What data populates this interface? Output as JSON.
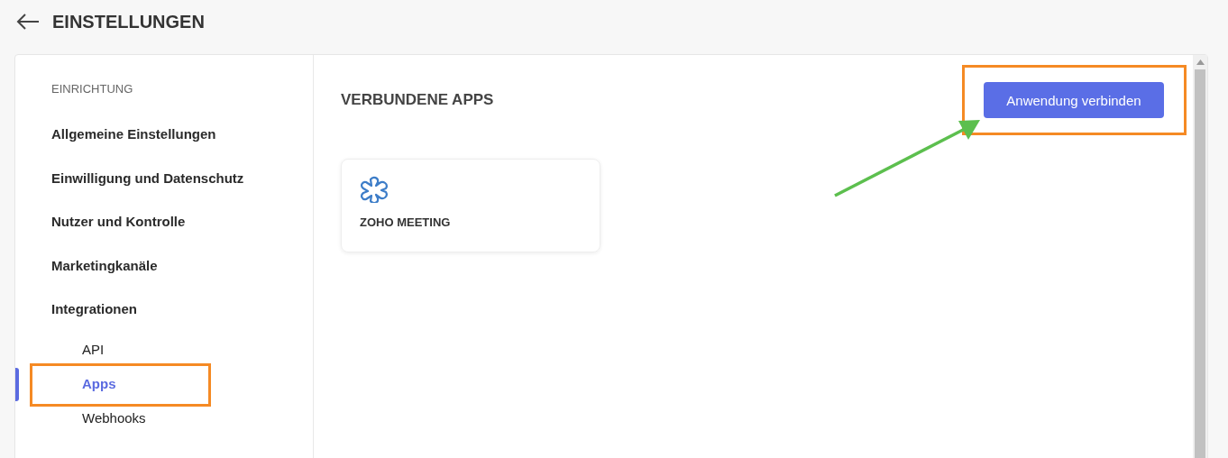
{
  "header": {
    "title": "EINSTELLUNGEN"
  },
  "sidebar": {
    "section": "EINRICHTUNG",
    "items": [
      {
        "label": "Allgemeine Einstellungen",
        "selected": false
      },
      {
        "label": "Einwilligung und Datenschutz",
        "selected": false
      },
      {
        "label": "Nutzer und Kontrolle",
        "selected": false
      },
      {
        "label": "Marketingkanäle",
        "selected": false
      },
      {
        "label": "Integrationen",
        "selected": false,
        "children": [
          {
            "label": "API",
            "selected": false
          },
          {
            "label": "Apps",
            "selected": true
          },
          {
            "label": "Webhooks",
            "selected": false
          }
        ]
      }
    ]
  },
  "content": {
    "title": "VERBUNDENE APPS",
    "button": "Anwendung verbinden",
    "apps": [
      {
        "name": "ZOHO MEETING"
      }
    ]
  }
}
